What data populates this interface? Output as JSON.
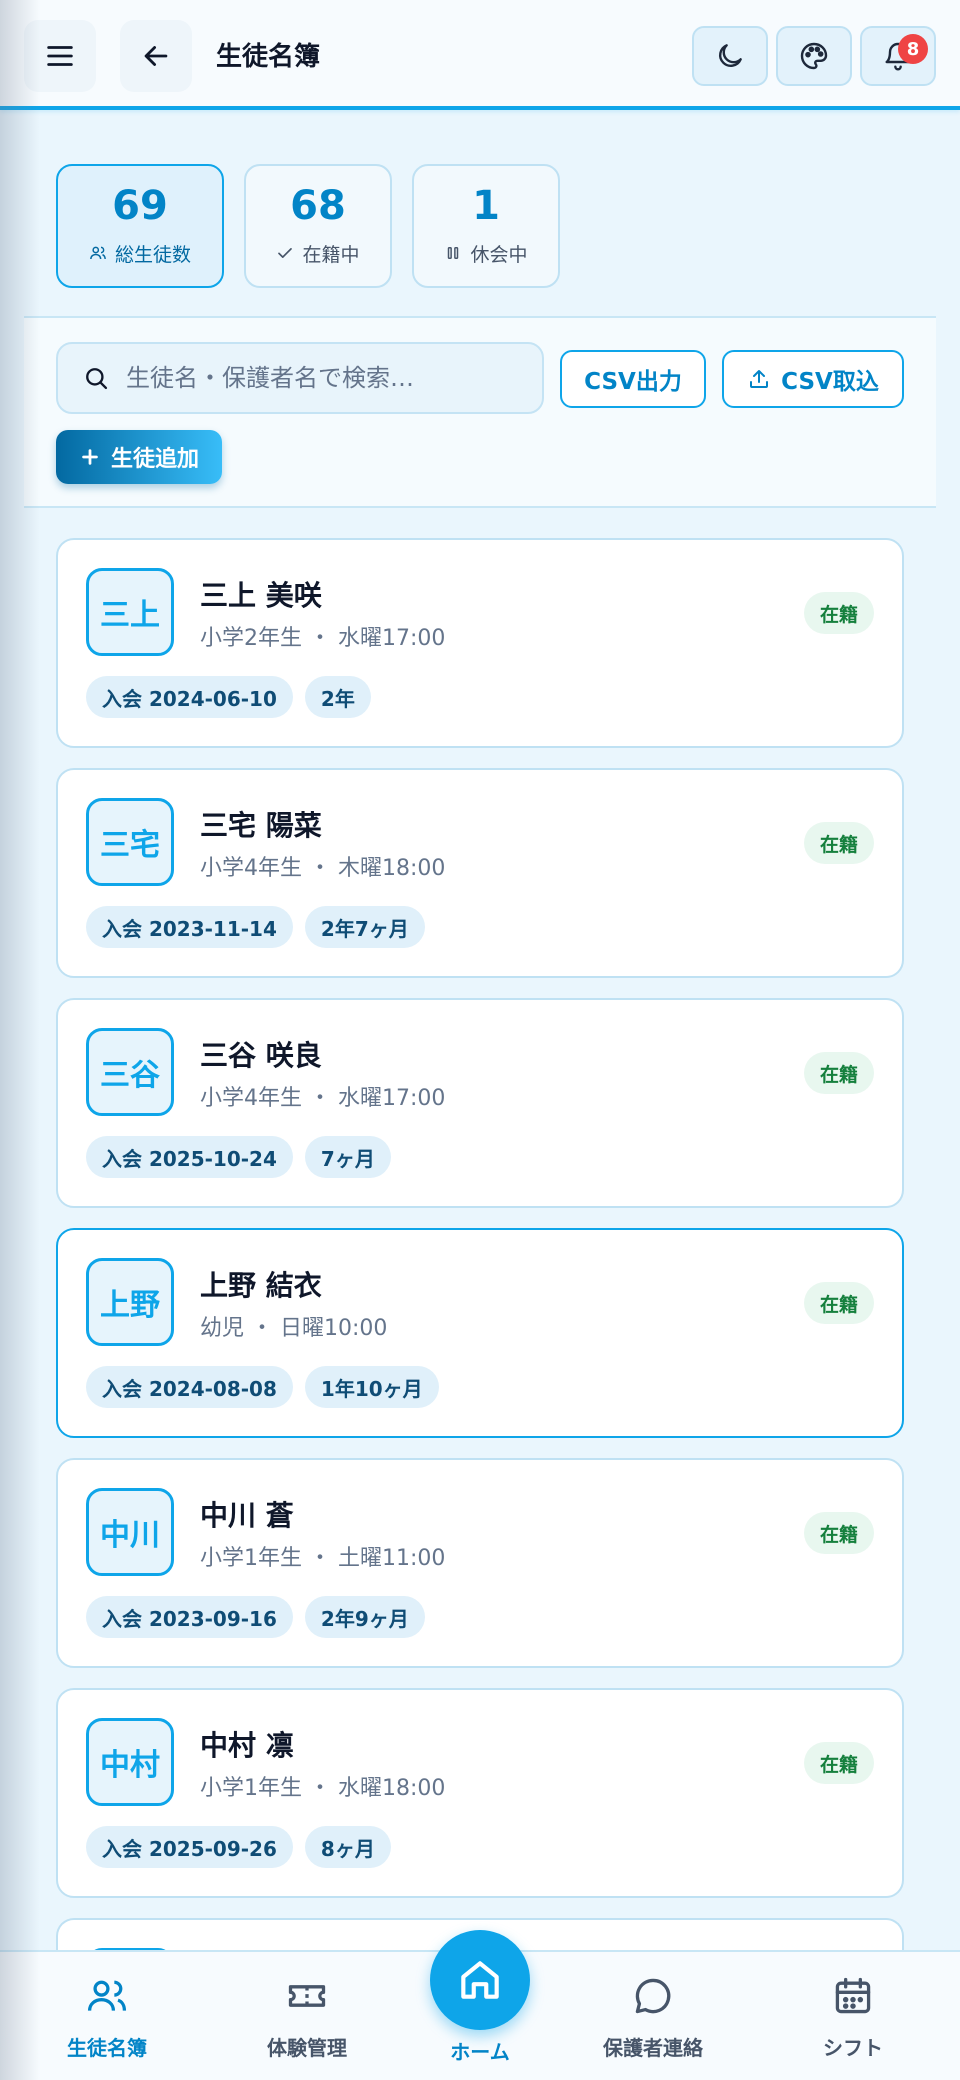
{
  "header": {
    "title": "生徒名簿",
    "notification_count": "8",
    "icons": [
      "menu-icon",
      "back-arrow-icon",
      "moon-icon",
      "palette-icon",
      "bell-icon"
    ]
  },
  "stats": [
    {
      "value": "69",
      "label": "総生徒数",
      "icon": "users-icon"
    },
    {
      "value": "68",
      "label": "在籍中",
      "icon": "check-icon"
    },
    {
      "value": "1",
      "label": "休会中",
      "icon": "pause-icon"
    }
  ],
  "toolbar": {
    "search_placeholder": "生徒名・保護者名で検索…",
    "csv_export": "CSV出力",
    "csv_import": "CSV取込",
    "add_student": "生徒追加"
  },
  "students": [
    {
      "avatar": "三上",
      "name": "三上 美咲",
      "meta": "小学2年生 ・ 水曜17:00",
      "status": "在籍",
      "joined": "入会 2024-06-10",
      "tenure": "2年"
    },
    {
      "avatar": "三宅",
      "name": "三宅 陽菜",
      "meta": "小学4年生 ・ 木曜18:00",
      "status": "在籍",
      "joined": "入会 2023-11-14",
      "tenure": "2年7ヶ月"
    },
    {
      "avatar": "三谷",
      "name": "三谷 咲良",
      "meta": "小学4年生 ・ 水曜17:00",
      "status": "在籍",
      "joined": "入会 2025-10-24",
      "tenure": "7ヶ月"
    },
    {
      "avatar": "上野",
      "name": "上野 結衣",
      "meta": "幼児 ・ 日曜10:00",
      "status": "在籍",
      "joined": "入会 2024-08-08",
      "tenure": "1年10ヶ月"
    },
    {
      "avatar": "中川",
      "name": "中川 蒼",
      "meta": "小学1年生 ・ 土曜11:00",
      "status": "在籍",
      "joined": "入会 2023-09-16",
      "tenure": "2年9ヶ月"
    },
    {
      "avatar": "中村",
      "name": "中村 凛",
      "meta": "小学1年生 ・ 水曜18:00",
      "status": "在籍",
      "joined": "入会 2025-09-26",
      "tenure": "8ヶ月"
    }
  ],
  "nav": {
    "roster": "生徒名簿",
    "trial": "体験管理",
    "home": "ホーム",
    "parents": "保護者連絡",
    "shift": "シフト"
  },
  "colors": {
    "accent": "#0ea5e9",
    "accent_dark": "#0284c7",
    "status_green": "#15803d",
    "badge_red": "#ef4444"
  }
}
